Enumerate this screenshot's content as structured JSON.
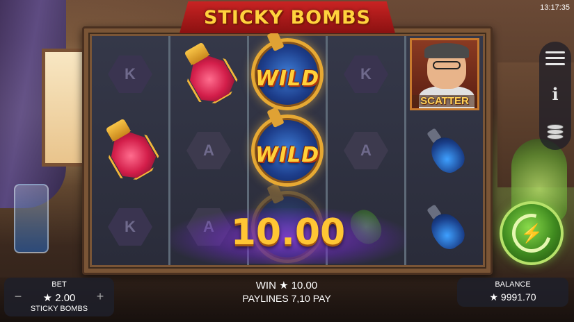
{
  "game": {
    "title": "STICKY BOMBS",
    "clock": "13:17:35"
  },
  "reels": [
    {
      "symbols": [
        "K",
        "red-potion",
        "K"
      ]
    },
    {
      "symbols": [
        "red-potion",
        "A",
        "A"
      ]
    },
    {
      "symbols": [
        "wild",
        "wild",
        "wild"
      ]
    },
    {
      "symbols": [
        "K",
        "A",
        "green-potion"
      ]
    },
    {
      "symbols": [
        "scatter",
        "blue-potion",
        "blue-potion"
      ]
    }
  ],
  "symbols": {
    "wild_label": "WILD",
    "scatter_label": "SCATTER",
    "k_label": "K",
    "a_label": "A"
  },
  "win_amount": "10.00",
  "bet": {
    "title": "BET",
    "value": "★ 2.00",
    "minus": "−",
    "plus": "+",
    "game_name": "STICKY BOMBS"
  },
  "status": {
    "win": "WIN ★ 10.00",
    "paylines": "PAYLINES 7,10 PAY"
  },
  "balance": {
    "title": "BALANCE",
    "value": "★ 9991.70"
  },
  "icons": {
    "menu": "hamburger-menu-icon",
    "info": "info-icon",
    "coins": "coin-stack-icon",
    "spin": "spin-lightning-icon"
  },
  "colors": {
    "accent_gold": "#ffc634",
    "logo_red": "#c92323",
    "spin_green": "#3f8a1f"
  }
}
